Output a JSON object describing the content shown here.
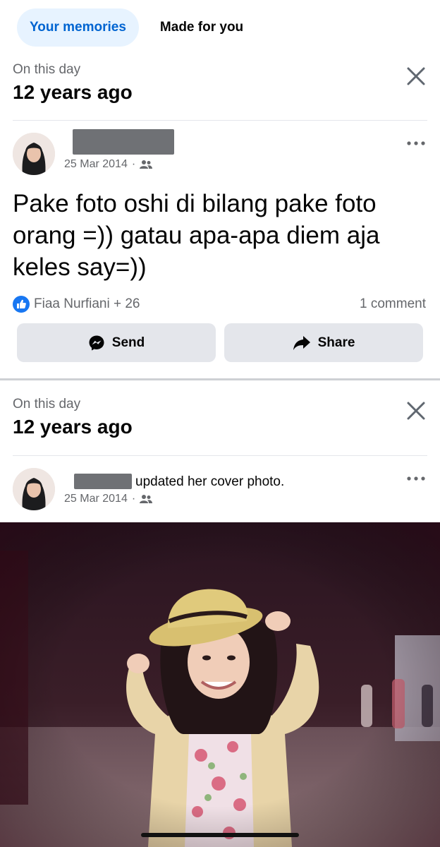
{
  "tabs": {
    "your_memories": "Your memories",
    "made_for_you": "Made for you"
  },
  "memories": [
    {
      "on_this_day": "On this day",
      "years_ago": "12 years ago",
      "post": {
        "date": "25 Mar 2014",
        "audience_icon": "friends-icon",
        "text": "Pake foto oshi di bilang pake foto orang =)) gatau apa-apa diem aja keles say=))",
        "reactions_label": "Fiaa Nurfiani + 26",
        "comments_label": "1 comment",
        "send_label": "Send",
        "share_label": "Share"
      }
    },
    {
      "on_this_day": "On this day",
      "years_ago": "12 years ago",
      "post": {
        "action": "updated her cover photo.",
        "date": "25 Mar 2014",
        "audience_icon": "friends-icon"
      }
    }
  ],
  "colors": {
    "accent": "#0064d1",
    "active_tab_bg": "#e7f3ff",
    "button_bg": "#e4e6eb",
    "like_blue": "#1877f2",
    "secondary_text": "#65676b"
  }
}
